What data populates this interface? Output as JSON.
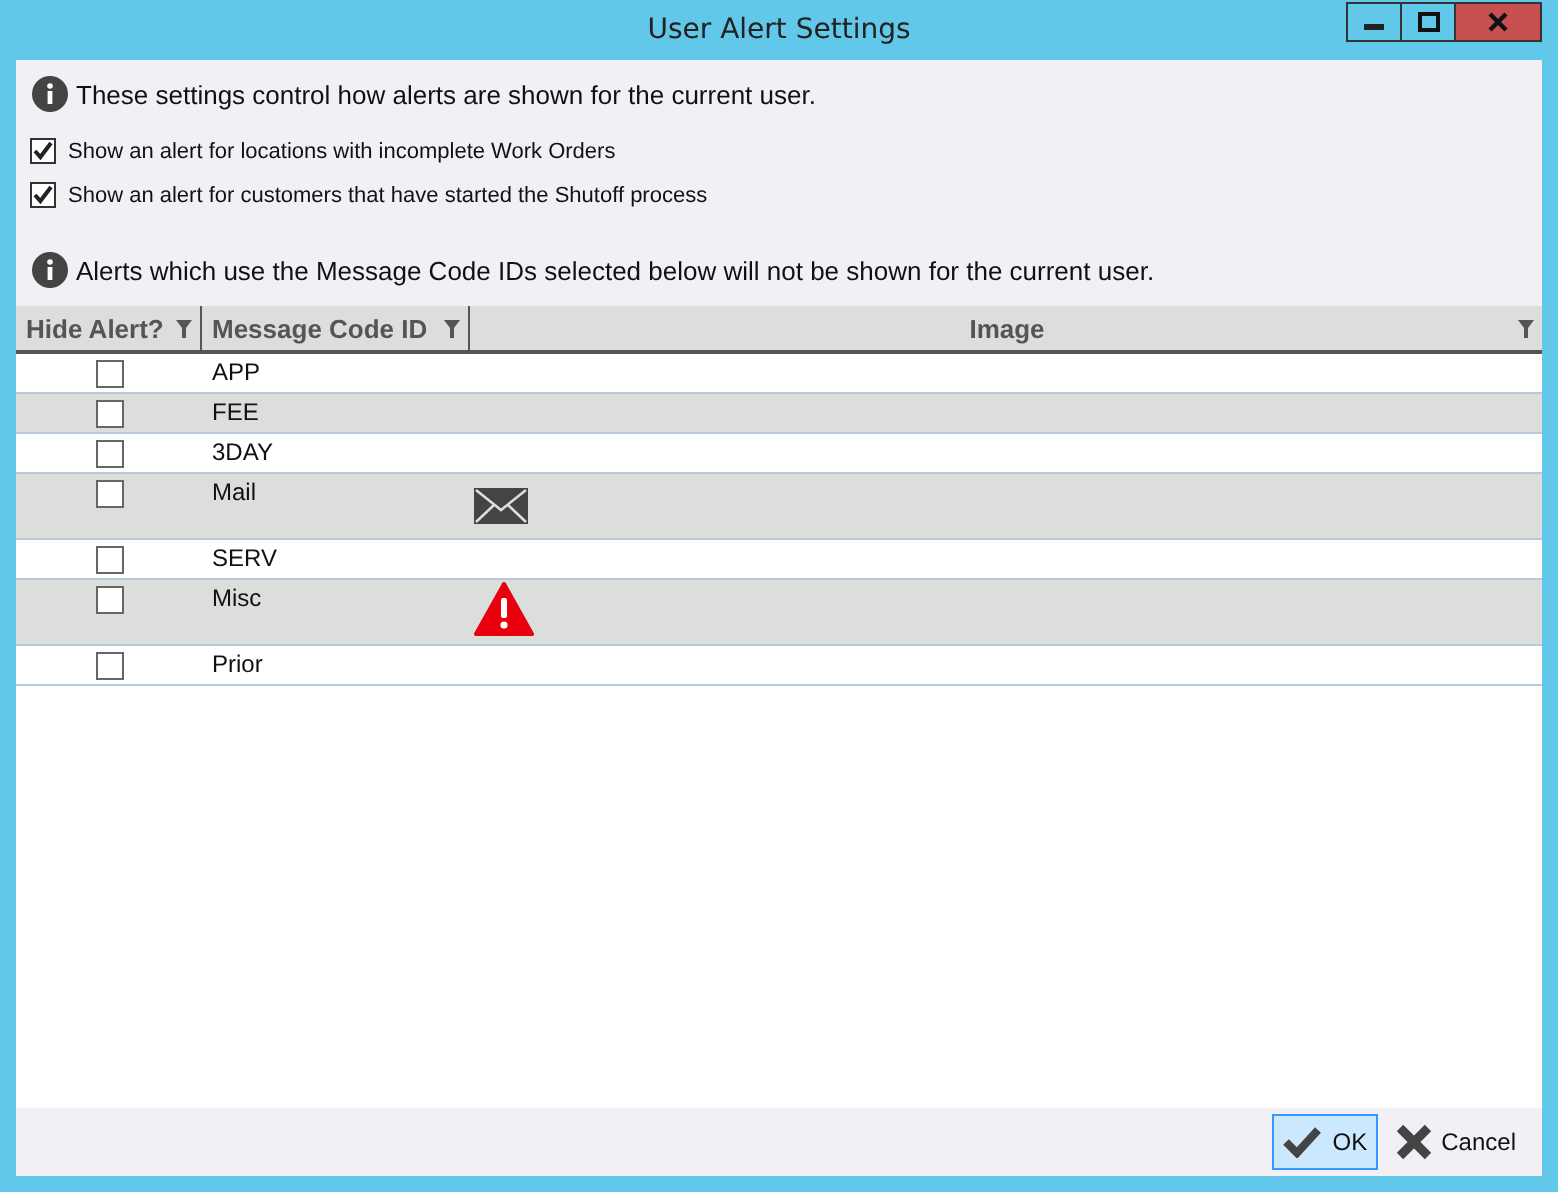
{
  "window": {
    "title": "User Alert Settings"
  },
  "intro": "These settings control how alerts are shown for the current user.",
  "options": [
    {
      "label": "Show an alert for locations with incomplete Work Orders",
      "checked": true
    },
    {
      "label": "Show an alert for customers that have started the Shutoff process",
      "checked": true
    }
  ],
  "grid_note": "Alerts which use the Message Code IDs selected below will not be shown for the current user.",
  "table": {
    "columns": [
      "Hide Alert?",
      "Message Code ID",
      "Image"
    ],
    "rows": [
      {
        "hide": false,
        "code": "APP"
      },
      {
        "hide": false,
        "code": "FEE"
      },
      {
        "hide": false,
        "code": "3DAY"
      },
      {
        "hide": false,
        "code": "Mail",
        "kind": "envelope"
      },
      {
        "hide": false,
        "code": "SERV"
      },
      {
        "hide": false,
        "code": "Misc",
        "kind": "warning"
      },
      {
        "hide": false,
        "code": "Prior"
      }
    ]
  },
  "buttons": [
    {
      "label": "OK",
      "kind": "ok",
      "selected": true
    },
    {
      "label": "Cancel",
      "kind": "cancel",
      "selected": false
    }
  ]
}
